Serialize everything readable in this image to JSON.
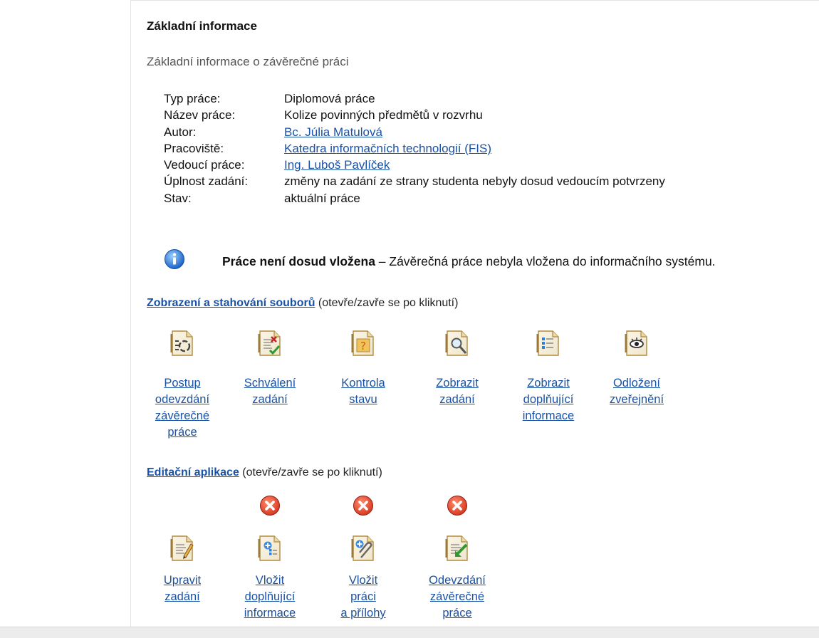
{
  "section": {
    "title": "Základní informace",
    "subtitle": "Základní informace o závěrečné práci"
  },
  "info_rows": [
    {
      "label": "Typ práce:",
      "value": "Diplomová práce",
      "link": false
    },
    {
      "label": "Název práce:",
      "value": "Kolize povinných předmětů v rozvrhu",
      "link": false
    },
    {
      "label": "Autor:",
      "value": "Bc. Júlia Matulová",
      "link": true
    },
    {
      "label": "Pracoviště:",
      "value": "Katedra informačních technologií (FIS)",
      "link": true
    },
    {
      "label": "Vedoucí práce:",
      "value": "Ing. Luboš Pavlíček",
      "link": true
    },
    {
      "label": "Úplnost zadání:",
      "value": "změny na zadání ze strany studenta nebyly dosud vedoucím potvrzeny",
      "link": false
    },
    {
      "label": "Stav:",
      "value": "aktuální práce",
      "link": false
    }
  ],
  "notice": {
    "icon": "info-icon",
    "bold": "Práce není dosud vložena",
    "text": " – Závěrečná práce nebyla vložena do informačního systému."
  },
  "files_section": {
    "link": "Zobrazení a stahování souborů",
    "hint": " (otevře/zavře se po kliknutí)",
    "items": [
      {
        "label": "Postup\nodevzdání\nzávěrečné\npráce",
        "icon": "progress-document-icon"
      },
      {
        "label": "Schválení\nzadání",
        "icon": "approval-document-icon"
      },
      {
        "label": "Kontrola\nstavu",
        "icon": "status-check-document-icon"
      },
      {
        "label": "Zobrazit\nzadání",
        "icon": "view-assignment-icon"
      },
      {
        "label": "Zobrazit\ndoplňující\ninformace",
        "icon": "additional-info-icon"
      },
      {
        "label": "Odložení\nzveřejnění",
        "icon": "publication-delay-icon"
      }
    ]
  },
  "edit_section": {
    "link": "Editační aplikace",
    "hint": " (otevře/zavře se po kliknutí)",
    "items": [
      {
        "label": "Upravit\nzadání",
        "icon": "edit-assignment-icon",
        "blocked": false
      },
      {
        "label": "Vložit\ndoplňující\ninformace",
        "icon": "insert-info-icon",
        "blocked": true
      },
      {
        "label": "Vložit\npráci\na přílohy",
        "icon": "insert-attachments-icon",
        "blocked": true
      },
      {
        "label": "Odevzdání\nzávěrečné\npráce",
        "icon": "submit-thesis-icon",
        "blocked": true
      }
    ]
  },
  "colors": {
    "link": "#1a52a5",
    "doc_fill": "#efe6cc",
    "deny": "#d83a22",
    "info": "#2f7fd8"
  }
}
